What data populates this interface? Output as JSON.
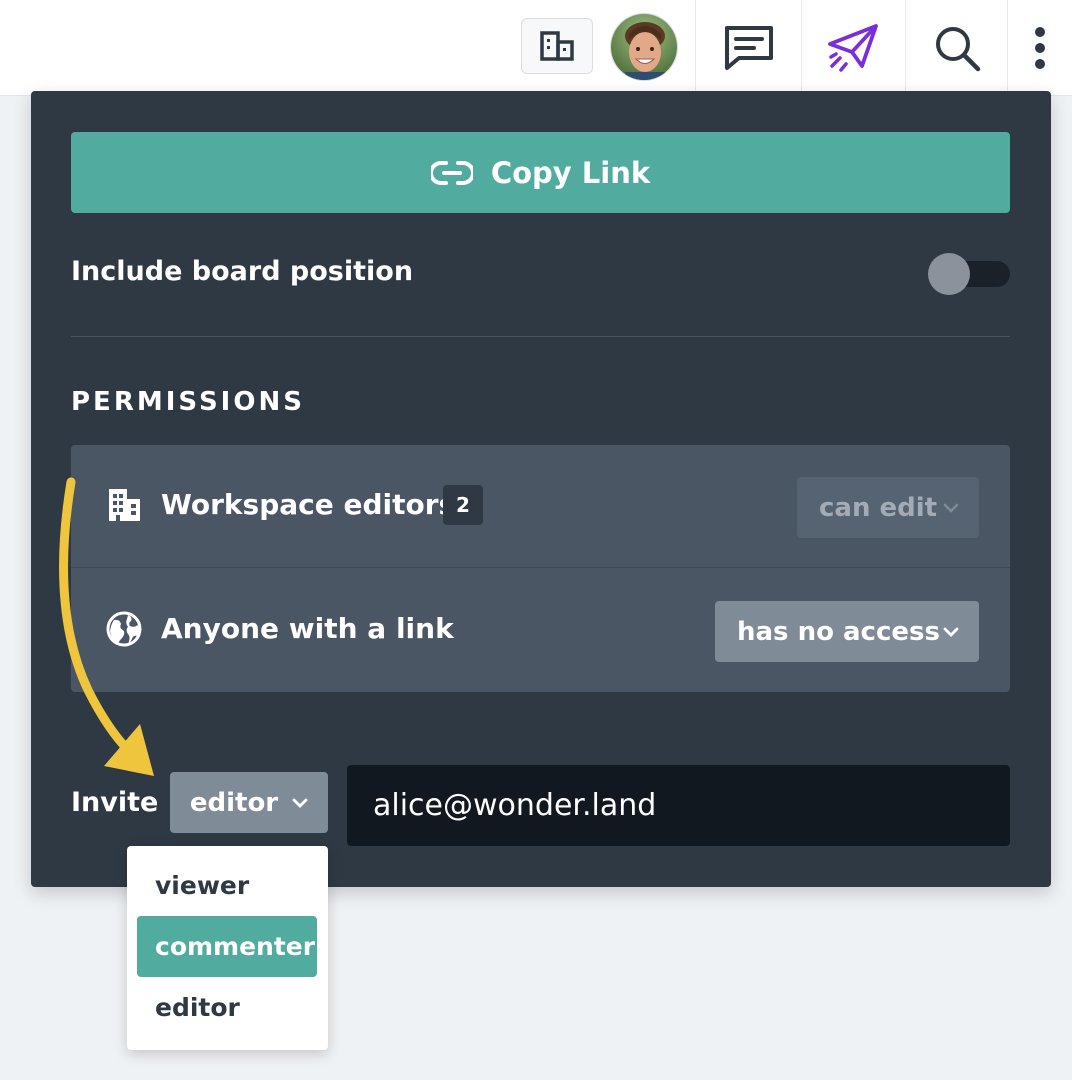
{
  "topbar": {
    "icons": [
      "workspace-icon",
      "avatar",
      "comment-icon",
      "share-send-icon",
      "search-icon",
      "more-vertical-icon"
    ],
    "accent_share_color": "#7b2cdb"
  },
  "share_panel": {
    "copy_link_label": "Copy Link",
    "include_board_position_label": "Include board position",
    "include_board_position_on": false,
    "permissions_heading": "PERMISSIONS",
    "permissions": [
      {
        "icon": "building-icon",
        "label": "Workspace editors",
        "count": "2",
        "access": "can edit",
        "enabled": false
      },
      {
        "icon": "globe-icon",
        "label": "Anyone with a link",
        "access": "has no access",
        "enabled": true
      }
    ],
    "invite_label": "Invite",
    "invite_role": "editor",
    "invite_email": "alice@wonder.land"
  },
  "role_menu": {
    "options": [
      "viewer",
      "commenter",
      "editor"
    ],
    "highlighted": "commenter"
  },
  "colors": {
    "panel_bg": "#2e3944",
    "accent_green": "#52ab9f",
    "annotation_arrow": "#efc53e"
  }
}
